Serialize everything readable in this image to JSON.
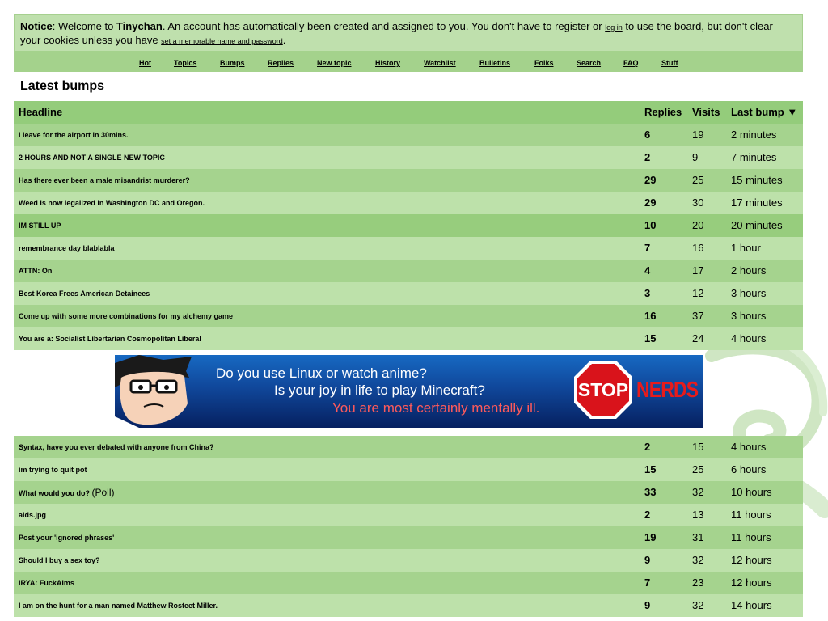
{
  "notice": {
    "label": "Notice",
    "text_1": ": Welcome to ",
    "site_name": "Tinychan",
    "text_2": ". An account has automatically been created and assigned to you. You don't have to register or ",
    "login_link": "log in",
    "text_3": " to use the board, but don't clear your cookies unless you have ",
    "name_link": "set a memorable name and password",
    "text_4": "."
  },
  "nav": [
    "Hot",
    "Topics",
    "Bumps",
    "Replies",
    "New topic",
    "History",
    "Watchlist",
    "Bulletins",
    "Folks",
    "Search",
    "FAQ",
    "Stuff"
  ],
  "page_title": "Latest bumps",
  "columns": {
    "headline": "Headline",
    "replies": "Replies",
    "visits": "Visits",
    "last_bump": "Last bump ▼"
  },
  "topics_top": [
    {
      "headline": "I leave for the airport in 30mins.",
      "replies": "6",
      "visits": "19",
      "last_bump": "2 minutes"
    },
    {
      "headline": "2 HOURS AND NOT A SINGLE NEW TOPIC",
      "replies": "2",
      "visits": "9",
      "last_bump": "7 minutes"
    },
    {
      "headline": "Has there ever been a male misandrist murderer?",
      "replies": "29",
      "visits": "25",
      "last_bump": "15 minutes"
    },
    {
      "headline": "Weed is now legalized in Washington DC and Oregon.",
      "replies": "29",
      "visits": "30",
      "last_bump": "17 minutes"
    },
    {
      "headline": "IM STILL UP",
      "replies": "10",
      "visits": "20",
      "last_bump": "20 minutes"
    },
    {
      "headline": "remembrance day blablabla",
      "replies": "7",
      "visits": "16",
      "last_bump": "1 hour"
    },
    {
      "headline": "ATTN: On",
      "replies": "4",
      "visits": "17",
      "last_bump": "2 hours"
    },
    {
      "headline": "Best Korea Frees American Detainees",
      "replies": "3",
      "visits": "12",
      "last_bump": "3 hours"
    },
    {
      "headline": "Come up with some more combinations for my alchemy game",
      "replies": "16",
      "visits": "37",
      "last_bump": "3 hours"
    },
    {
      "headline": "You are a: Socialist Libertarian Cosmopolitan Liberal",
      "replies": "15",
      "visits": "24",
      "last_bump": "4 hours"
    }
  ],
  "banner": {
    "line_1": "Do you use Linux or watch anime?",
    "line_2": "Is your joy in life to play Minecraft?",
    "line_3": "You are most certainly mentally ill.",
    "stop": "STOP",
    "nerds": "NERDS"
  },
  "topics_bottom": [
    {
      "headline": "Syntax, have you ever debated with anyone from China?",
      "replies": "2",
      "visits": "15",
      "last_bump": "4 hours"
    },
    {
      "headline": "im trying to quit pot",
      "replies": "15",
      "visits": "25",
      "last_bump": "6 hours"
    },
    {
      "headline": "What would you do?",
      "tag": "(Poll)",
      "replies": "33",
      "visits": "32",
      "last_bump": "10 hours"
    },
    {
      "headline": "aids.jpg",
      "replies": "2",
      "visits": "13",
      "last_bump": "11 hours"
    },
    {
      "headline": "Post your 'ignored phrases'",
      "replies": "19",
      "visits": "31",
      "last_bump": "11 hours"
    },
    {
      "headline": "Should I buy a sex toy?",
      "replies": "9",
      "visits": "32",
      "last_bump": "12 hours"
    },
    {
      "headline": "IRYA: FuckAlms",
      "replies": "7",
      "visits": "23",
      "last_bump": "12 hours"
    },
    {
      "headline": "I am on the hunt for a man named Matthew Rosteet Miller.",
      "replies": "9",
      "visits": "32",
      "last_bump": "14 hours"
    }
  ],
  "colors": {
    "row_a": "#a5d38e",
    "row_b": "#bde1aa",
    "header": "#94cc7b",
    "notice_bg": "#bfe0ad"
  }
}
